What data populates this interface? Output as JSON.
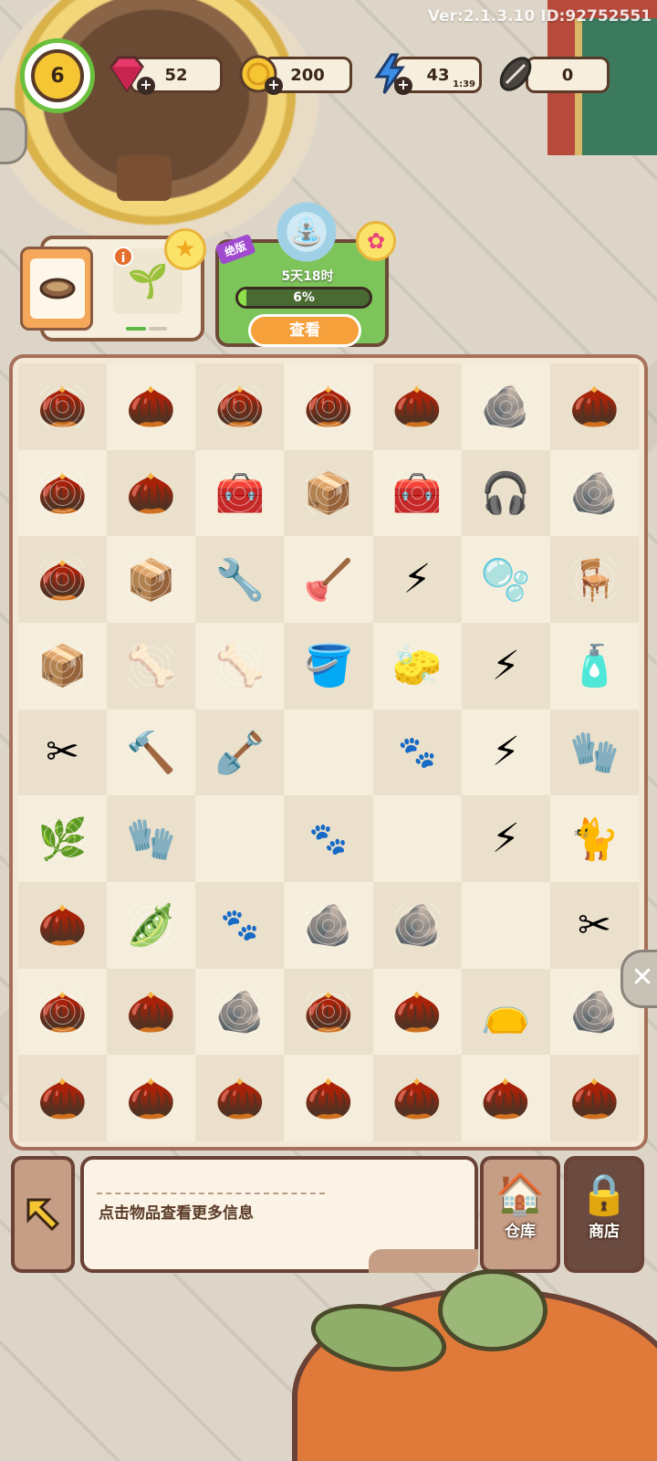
{
  "version_text": "Ver:2.1.3.10 ID:92752551",
  "player": {
    "level": "6"
  },
  "resources": {
    "gems": {
      "value": "52",
      "icon": "gem-icon"
    },
    "coins": {
      "value": "200",
      "icon": "coin-icon"
    },
    "energy": {
      "value": "43",
      "timer": "1:39",
      "icon": "lightning-icon"
    },
    "seeds": {
      "value": "0",
      "icon": "sunflower-seed-icon"
    }
  },
  "order": {
    "info_badge": "i"
  },
  "event": {
    "ribbon": "绝版",
    "time_left": "5天18时",
    "progress_label": "6%",
    "progress": 0.06,
    "button_label": "查看"
  },
  "board": {
    "columns": 7,
    "rows": 9,
    "cells": [
      [
        "acorn-web",
        "acorn",
        "acorn-web",
        "acorn-web",
        "acorn",
        "pebble-web",
        "acorn-dusty"
      ],
      [
        "acorn-web",
        "acorn-dusty",
        "toolbox-web",
        "crate-web",
        "toolbox-web",
        "headphones",
        "stone-web"
      ],
      [
        "acorn-web",
        "crate-web",
        "wrench",
        "plunger",
        "energy-bucket",
        "bubble-sheet",
        "bench-web"
      ],
      [
        "crate-web",
        "bone-web",
        "bones-web",
        "paw-bucket",
        "brush",
        "energy-cabinet",
        "spray-bottle"
      ],
      [
        "pruning-shears",
        "hammer",
        "trowel",
        "empty",
        "paw",
        "energy-bucket",
        "paw-glove"
      ],
      [
        "sapling-web",
        "paw-gloves",
        "empty",
        "paw",
        "empty",
        "energy-orb",
        "black-cat"
      ],
      [
        "acorn",
        "pea-pods-web",
        "paw",
        "rock-web",
        "rock-web",
        "empty",
        "scissors"
      ],
      [
        "acorn-web",
        "acorn-dusty",
        "rock-web",
        "acorn-web",
        "acorn",
        "sack",
        "pebbles-web"
      ],
      [
        "acorn-dusty",
        "acorn-dusty",
        "acorn-dusty",
        "acorn-dusty",
        "acorn-dusty",
        "acorn-dusty",
        "acorn-dusty"
      ]
    ]
  },
  "info_panel": {
    "hint": "点击物品查看更多信息"
  },
  "buttons": {
    "warehouse": "仓库",
    "shop": "商店"
  }
}
